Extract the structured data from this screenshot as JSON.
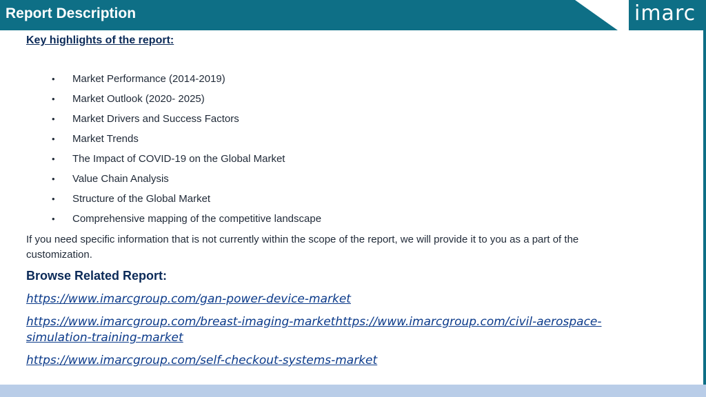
{
  "header": {
    "title": "Report Description",
    "logo": "imarc"
  },
  "colors": {
    "header": "#0e6f86",
    "heading": "#0b2a58",
    "link": "#0b3a8a",
    "bottom_band": "#b9cde8"
  },
  "key_highlights": {
    "heading": "Key highlights of the report:",
    "bullet": "•",
    "items": [
      "Market Performance (2014-2019)",
      "Market Outlook (2020- 2025)",
      "Market Drivers and Success Factors",
      "Market Trends",
      "The Impact of COVID-19 on the Global Market",
      "Value Chain Analysis",
      "Structure of the Global Market",
      "Comprehensive mapping of the competitive landscape"
    ]
  },
  "note": "If you need specific information that is not currently within the scope of the report, we will provide it to you as a part of the customization.",
  "related": {
    "heading": "Browse Related Report:",
    "links": [
      "https://www.imarcgroup.com/gan-power-device-market",
      "https://www.imarcgroup.com/breast-imaging-markethttps://www.imarcgroup.com/civil-aerospace-simulation-training-market",
      "https://www.imarcgroup.com/self-checkout-systems-market"
    ]
  }
}
